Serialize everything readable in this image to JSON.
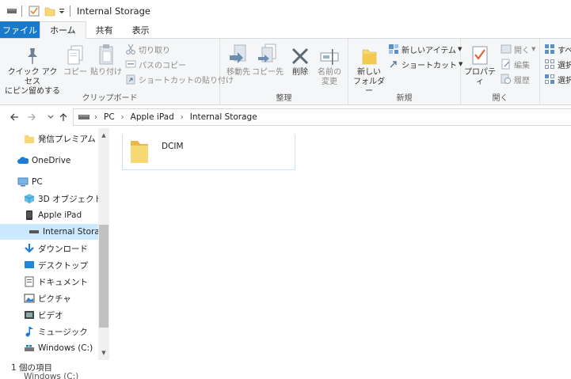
{
  "window": {
    "title": "Internal Storage"
  },
  "quick_access": [
    {
      "icon": "drive-icon"
    },
    {
      "icon": "properties-check-icon"
    },
    {
      "icon": "new-folder-icon"
    },
    {
      "icon": "dropdown-arrow-icon"
    }
  ],
  "tabs": {
    "file": "ファイル",
    "home": "ホーム",
    "share": "共有",
    "view": "表示"
  },
  "ribbon": {
    "clipboard": {
      "label": "クリップボード",
      "pin": "クイック アクセス\nにピン留めする",
      "copy": "コピー",
      "paste": "貼り付け",
      "cut": "切り取り",
      "copy_path": "パスのコピー",
      "paste_shortcut": "ショートカットの貼り付け"
    },
    "organize": {
      "label": "整理",
      "move_to": "移動先",
      "copy_to": "コピー先",
      "delete": "削除",
      "rename": "名前の\n変更"
    },
    "new": {
      "label": "新規",
      "new_folder": "新しい\nフォルダー",
      "new_item": "新しいアイテム",
      "shortcut": "ショートカット"
    },
    "open": {
      "label": "開く",
      "properties": "プロパティ",
      "open": "開く",
      "edit": "編集",
      "history": "履歴"
    },
    "select": {
      "all": "すべ",
      "none": "選択",
      "invert": "選択"
    }
  },
  "address": {
    "crumbs": [
      "PC",
      "Apple iPad",
      "Internal Storage"
    ]
  },
  "nav": {
    "items": [
      {
        "label": "発信プレミアム",
        "icon": "folder-icon"
      },
      {
        "label": "OneDrive",
        "icon": "cloud-icon"
      },
      {
        "label": "PC",
        "icon": "pc-icon"
      },
      {
        "label": "3D オブジェクト",
        "icon": "3d-objects-icon"
      },
      {
        "label": "Apple iPad",
        "icon": "ipad-icon"
      },
      {
        "label": "Internal Storage",
        "icon": "drive-icon"
      },
      {
        "label": "ダウンロード",
        "icon": "download-icon"
      },
      {
        "label": "デスクトップ",
        "icon": "desktop-icon"
      },
      {
        "label": "ドキュメント",
        "icon": "documents-icon"
      },
      {
        "label": "ピクチャ",
        "icon": "pictures-icon"
      },
      {
        "label": "ビデオ",
        "icon": "videos-icon"
      },
      {
        "label": "ミュージック",
        "icon": "music-icon"
      },
      {
        "label": "Windows (C:)",
        "icon": "windows-drive-icon"
      }
    ]
  },
  "content": {
    "items": [
      {
        "name": "DCIM",
        "icon": "folder-icon"
      }
    ]
  },
  "status": {
    "count": "1 個の項目",
    "partial": "Windows (C:)"
  },
  "colors": {
    "file_tab": "#1979ca",
    "selection": "#cce8ff",
    "folder": "#f8d775"
  }
}
